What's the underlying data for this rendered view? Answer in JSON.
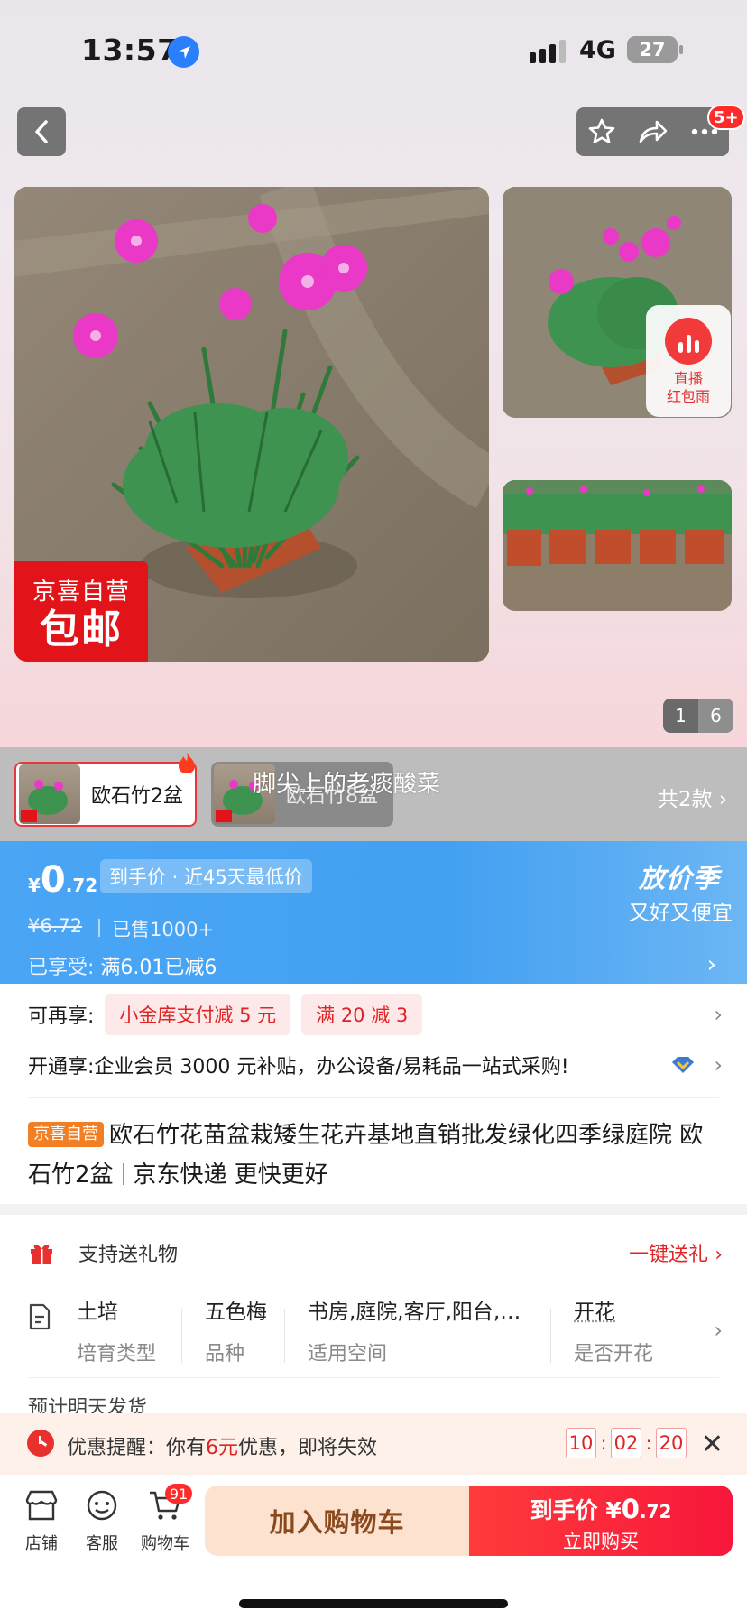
{
  "status_bar": {
    "time": "13:57",
    "network": "4G",
    "battery": "27"
  },
  "header": {
    "message_badge": "5+"
  },
  "gallery": {
    "promo_badge": {
      "line1": "京喜自营",
      "line2": "包邮"
    },
    "live_widget": {
      "line1": "直播",
      "line2": "红包雨"
    },
    "page_current": "1",
    "page_total": "6"
  },
  "variants": {
    "items": [
      {
        "label": "欧石竹2盆",
        "selected": true
      },
      {
        "label": "欧石竹8盆",
        "selected": false
      }
    ],
    "count_label": "共2款",
    "watermark": "脚尖上的老痰酸菜"
  },
  "price": {
    "currency": "¥",
    "integer": "0",
    "decimal": ".72",
    "tag": "到手价 · 近45天最低价",
    "old_price": "¥6.72",
    "sold": "已售1000+",
    "discount_label": "已享受:",
    "discount_value": "满6.01已减6",
    "season_title": "放价季",
    "season_sub": "又好又便宜"
  },
  "offers": {
    "extra_label": "可再享:",
    "coupons": [
      "小金库支付减 5 元",
      "满 20 减 3"
    ],
    "member_text": "开通享:企业会员 3000 元补贴，办公设备/易耗品一站式采购!"
  },
  "product": {
    "brand_tag": "京喜自营",
    "title_main": "欧石竹花苗盆栽矮生花卉基地直销批发绿化四季绿庭院 欧石竹2盆",
    "title_tail": "京东快递 更快更好"
  },
  "gift": {
    "label": "支持送礼物",
    "action": "一键送礼"
  },
  "attributes": [
    {
      "value": "土培",
      "key": "培育类型"
    },
    {
      "value": "五色梅",
      "key": "品种"
    },
    {
      "value": "书房,庭院,客厅,阳台,…",
      "key": "适用空间"
    },
    {
      "value": "开花",
      "key": "是否开花"
    }
  ],
  "shipping_peek": "预计明天发货",
  "reminder": {
    "prefix": "优惠提醒：你有",
    "amount": "6元",
    "suffix": "优惠，即将失效",
    "countdown": [
      "10",
      "02",
      "20"
    ]
  },
  "bottom_bar": {
    "tabs": [
      {
        "label": "店铺",
        "icon": "shop-icon"
      },
      {
        "label": "客服",
        "icon": "customer-service-icon"
      },
      {
        "label": "购物车",
        "icon": "cart-icon"
      }
    ],
    "cart_badge": "91",
    "add_to_cart": "加入购物车",
    "buy_label": "到手价",
    "buy_currency": "¥",
    "buy_integer": "0",
    "buy_decimal": ".72",
    "buy_sub": "立即购买"
  },
  "colors": {
    "accent_red": "#e02424",
    "price_blue": "#43a0f2",
    "brand_orange": "#f27f24"
  }
}
